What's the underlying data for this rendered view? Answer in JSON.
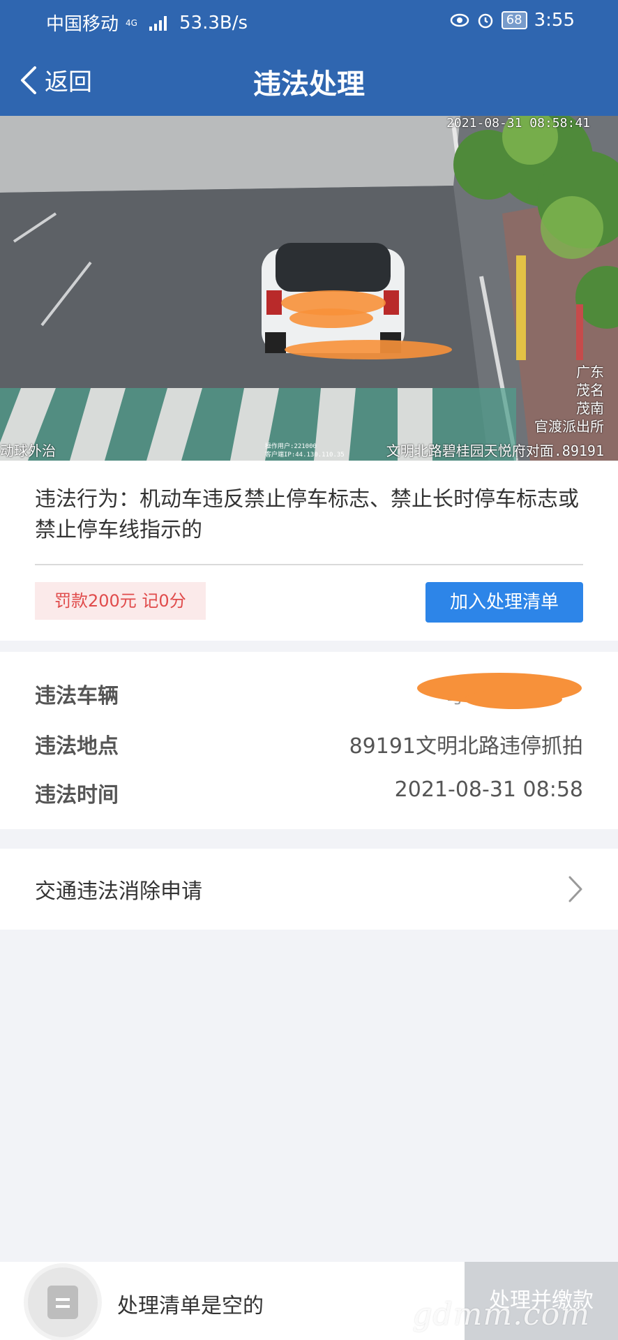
{
  "status_bar": {
    "carrier": "中国移动",
    "network": "4G",
    "speed": "53.3B/s",
    "battery": "68",
    "time": "3:55"
  },
  "nav": {
    "back_label": "返回",
    "title": "违法处理"
  },
  "photo": {
    "timestamp": "2021-08-31 08:58:41",
    "bottom_left": "动球外治",
    "location_text": "文明北路碧桂园天悦府对面.89191",
    "side_text": "广东\n茂名\n茂南\n官渡派出所",
    "tiny_text_1": "操作用户:221000",
    "tiny_text_2": "客户端IP:44.130.110.35"
  },
  "violation": {
    "behavior": "违法行为：机动车违反禁止停车标志、禁止长时停车标志或禁止停车线指示的",
    "fine": "罚款200元 记0分",
    "add_button": "加入处理清单"
  },
  "details": [
    {
      "label": "违法车辆",
      "value": "粤"
    },
    {
      "label": "违法地点",
      "value": "89191文明北路违停抓拍"
    },
    {
      "label": "违法时间",
      "value": "2021-08-31 08:58"
    }
  ],
  "appeal": {
    "label": "交通违法消除申请"
  },
  "bottom": {
    "empty_text": "处理清单是空的",
    "pay_button": "处理并缴款"
  },
  "watermark": "gdmm.com",
  "colors": {
    "primary": "#2f66b0",
    "button": "#2d85e8",
    "fine_text": "#e04b4b",
    "fine_bg": "#fbeaea",
    "redaction": "#f7913a"
  }
}
